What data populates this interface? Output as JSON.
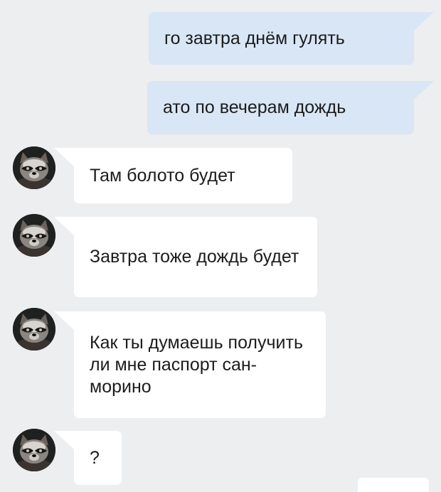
{
  "messages": [
    {
      "direction": "outgoing",
      "text": "го завтра днём гулять"
    },
    {
      "direction": "outgoing",
      "text": "ато по вечерам дождь"
    },
    {
      "direction": "incoming",
      "text": "Там болото будет",
      "avatar_icon": "raccoon-avatar-icon"
    },
    {
      "direction": "incoming",
      "text": "Завтра тоже дождь будет",
      "avatar_icon": "raccoon-avatar-icon"
    },
    {
      "direction": "incoming",
      "text": "Как ты думаешь получить ли мне паспорт сан-морино",
      "avatar_icon": "raccoon-avatar-icon"
    },
    {
      "direction": "incoming",
      "text": "?",
      "avatar_icon": "raccoon-avatar-icon"
    }
  ],
  "colors": {
    "background": "#edeef0",
    "outgoing_bubble": "#d9e6f5",
    "incoming_bubble": "#ffffff",
    "text": "#1c1c1c"
  }
}
